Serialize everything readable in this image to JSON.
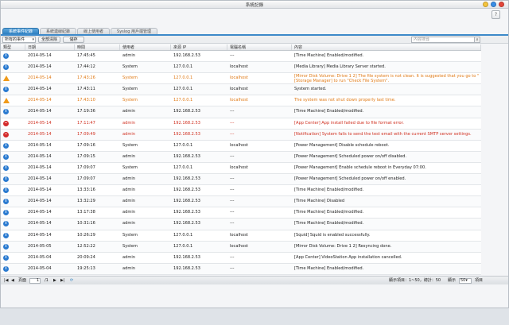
{
  "window": {
    "title": "系統記錄"
  },
  "tabs": [
    {
      "label": "系統事件紀錄"
    },
    {
      "label": "系統連線紀錄"
    },
    {
      "label": "線上使用者"
    },
    {
      "label": "Syslog 用戶端管理"
    }
  ],
  "toolbar": {
    "filter_value": "所有的事件",
    "clear_label": "全部清除",
    "save_label": "儲存",
    "search_placeholder": "內容搜尋"
  },
  "columns": [
    "類型",
    "日期",
    "時間",
    "使用者",
    "來源 IP",
    "電腦名稱",
    "內容"
  ],
  "rows": [
    {
      "type": "info",
      "date": "2014-05-14",
      "time": "17:45:45",
      "user": "admin",
      "ip": "192.168.2.53",
      "computer": "---",
      "content": "[Time Machine] Enabled/modified."
    },
    {
      "type": "info",
      "date": "2014-05-14",
      "time": "17:44:12",
      "user": "System",
      "ip": "127.0.0.1",
      "computer": "localhost",
      "content": "[Media Library] Media Library Server started."
    },
    {
      "type": "warn",
      "date": "2014-05-14",
      "time": "17:43:26",
      "user": "System",
      "ip": "127.0.0.1",
      "computer": "localhost",
      "content": "[Mirror Disk Volume: Drive 1 2] The file system is not clean. It is suggested that you go to \"[Storage Manager] to run \"Check File System\"."
    },
    {
      "type": "info",
      "date": "2014-05-14",
      "time": "17:43:11",
      "user": "System",
      "ip": "127.0.0.1",
      "computer": "localhost",
      "content": "System started."
    },
    {
      "type": "warn",
      "date": "2014-05-14",
      "time": "17:43:10",
      "user": "System",
      "ip": "127.0.0.1",
      "computer": "localhost",
      "content": "The system was not shut down properly last time."
    },
    {
      "type": "info",
      "date": "2014-05-14",
      "time": "17:19:36",
      "user": "admin",
      "ip": "192.168.2.53",
      "computer": "---",
      "content": "[Time Machine] Enabled/modified."
    },
    {
      "type": "err",
      "date": "2014-05-14",
      "time": "17:11:47",
      "user": "admin",
      "ip": "192.168.2.53",
      "computer": "---",
      "content": "[App Center] App install failed due to file format error."
    },
    {
      "type": "err",
      "date": "2014-05-14",
      "time": "17:09:49",
      "user": "admin",
      "ip": "192.168.2.53",
      "computer": "---",
      "content": "[Notification] System fails to send the test email with the current SMTP server settings."
    },
    {
      "type": "info",
      "date": "2014-05-14",
      "time": "17:09:16",
      "user": "System",
      "ip": "127.0.0.1",
      "computer": "localhost",
      "content": "[Power Management] Disable schedule reboot."
    },
    {
      "type": "info",
      "date": "2014-05-14",
      "time": "17:09:15",
      "user": "admin",
      "ip": "192.168.2.53",
      "computer": "---",
      "content": "[Power Management] Scheduled power on/off disabled."
    },
    {
      "type": "info",
      "date": "2014-05-14",
      "time": "17:09:07",
      "user": "System",
      "ip": "127.0.0.1",
      "computer": "localhost",
      "content": "[Power Management] Enable schedule reboot in Everyday 07:00."
    },
    {
      "type": "info",
      "date": "2014-05-14",
      "time": "17:09:07",
      "user": "admin",
      "ip": "192.168.2.53",
      "computer": "---",
      "content": "[Power Management] Scheduled power on/off enabled."
    },
    {
      "type": "info",
      "date": "2014-05-14",
      "time": "13:33:16",
      "user": "admin",
      "ip": "192.168.2.53",
      "computer": "---",
      "content": "[Time Machine] Enabled/modified."
    },
    {
      "type": "info",
      "date": "2014-05-14",
      "time": "13:32:29",
      "user": "admin",
      "ip": "192.168.2.53",
      "computer": "---",
      "content": "[Time Machine] Disabled"
    },
    {
      "type": "info",
      "date": "2014-05-14",
      "time": "13:17:38",
      "user": "admin",
      "ip": "192.168.2.53",
      "computer": "---",
      "content": "[Time Machine] Enabled/modified."
    },
    {
      "type": "info",
      "date": "2014-05-14",
      "time": "10:31:16",
      "user": "admin",
      "ip": "192.168.2.53",
      "computer": "---",
      "content": "[Time Machine] Enabled/modified."
    },
    {
      "type": "info",
      "date": "2014-05-14",
      "time": "10:26:29",
      "user": "System",
      "ip": "127.0.0.1",
      "computer": "localhost",
      "content": "[Squid] Squid is enabled successfully."
    },
    {
      "type": "info",
      "date": "2014-05-05",
      "time": "12:52:22",
      "user": "System",
      "ip": "127.0.0.1",
      "computer": "localhost",
      "content": "[Mirror Disk Volume: Drive 1 2] Resyncing done."
    },
    {
      "type": "info",
      "date": "2014-05-04",
      "time": "20:09:24",
      "user": "admin",
      "ip": "192.168.2.53",
      "computer": "---",
      "content": "[App Center] VideoStation App installation cancelled."
    },
    {
      "type": "info",
      "date": "2014-05-04",
      "time": "19:25:13",
      "user": "admin",
      "ip": "192.168.2.53",
      "computer": "---",
      "content": "[Time Machine] Enabled/modified."
    }
  ],
  "footer": {
    "page_label": "頁面",
    "page_value": "1",
    "page_total": "/1",
    "summary": "顯示項目：1~50，總計：50",
    "per_page_label": "顯示",
    "per_page_value": "50",
    "unit": "項目"
  },
  "colors": {
    "accent": "#2b7fc1",
    "warning": "#e07a16",
    "error": "#d03020"
  }
}
